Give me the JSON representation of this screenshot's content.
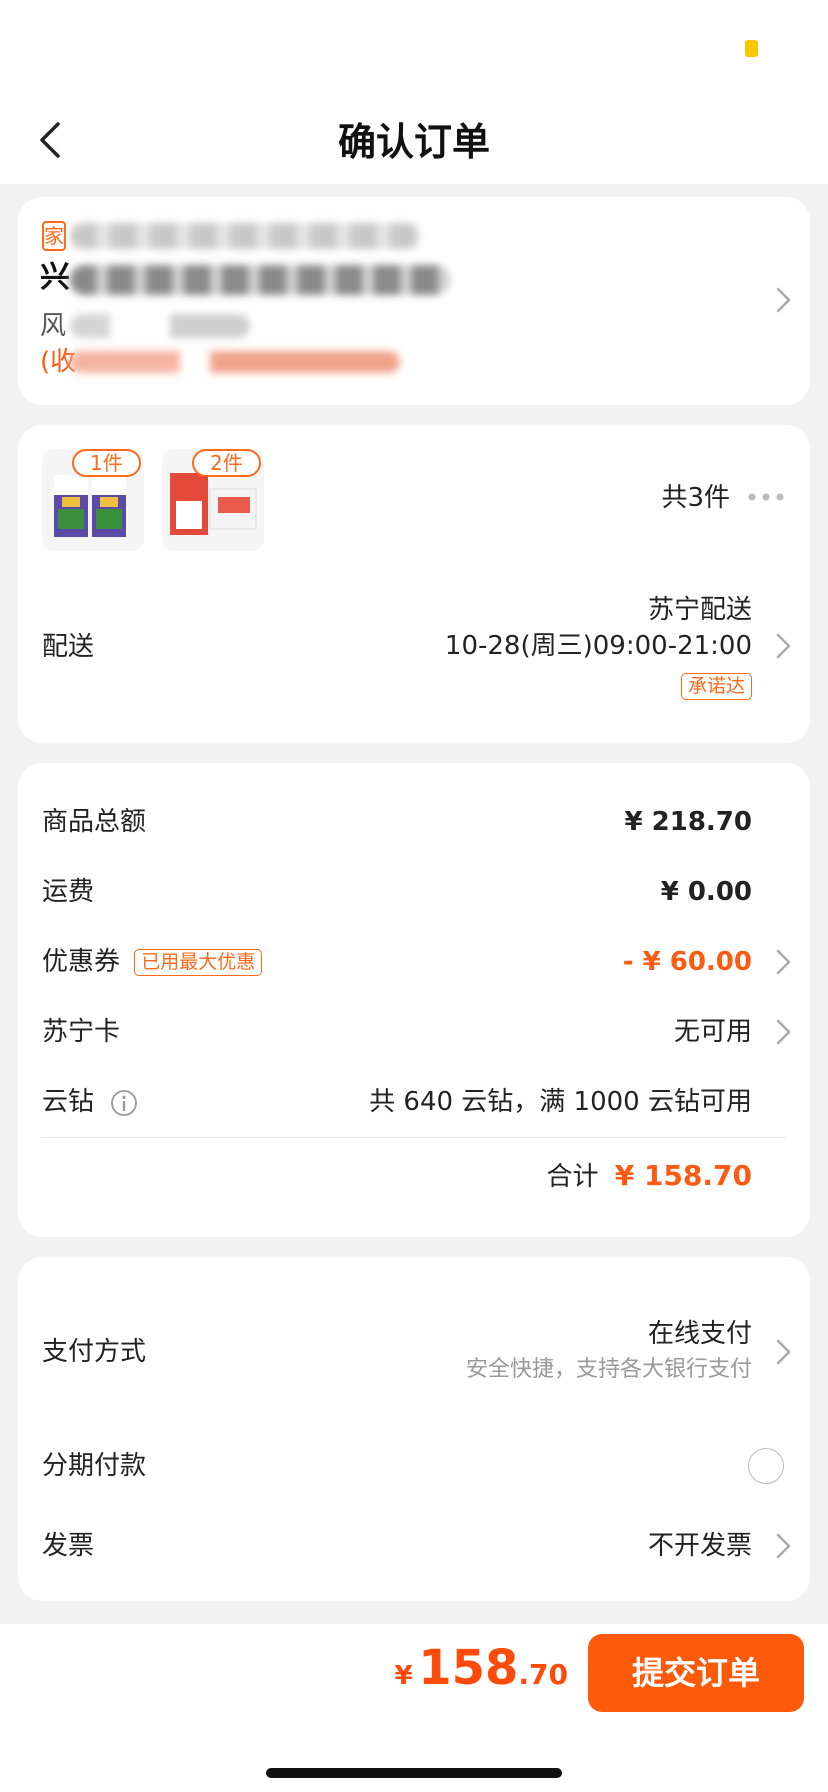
{
  "header": {
    "title": "确认订单"
  },
  "address": {
    "tag": "家",
    "line1_initial": "兴",
    "line2_initial": "风",
    "line3_initial": "(收"
  },
  "goods": {
    "items": [
      {
        "qty": "1件",
        "name": "milk-product-thumbnail"
      },
      {
        "qty": "2件",
        "name": "box-product-thumbnail"
      }
    ],
    "total_count": "共3件"
  },
  "delivery": {
    "label": "配送",
    "method": "苏宁配送",
    "time": "10-28(周三)09:00-21:00",
    "promise_tag": "承诺达"
  },
  "pricing": {
    "goods_total_label": "商品总额",
    "goods_total_value": "¥ 218.70",
    "shipping_label": "运费",
    "shipping_value": "¥ 0.00",
    "coupon_label": "优惠券",
    "coupon_tag": "已用最大优惠",
    "coupon_value": "- ¥ 60.00",
    "card_label": "苏宁卡",
    "card_value": "无可用",
    "yunzuan_label": "云钻",
    "yunzuan_value": "共 640 云钻，满 1000 云钻可用",
    "total_label": "合计",
    "total_value": "¥ 158.70"
  },
  "payment": {
    "method_label": "支付方式",
    "method_value": "在线支付",
    "method_sub": "安全快捷，支持各大银行支付",
    "installment_label": "分期付款",
    "invoice_label": "发票",
    "invoice_value": "不开发票"
  },
  "footer": {
    "currency": "¥",
    "amount_int": "158",
    "amount_dec": ".70",
    "submit_label": "提交订单"
  },
  "colors": {
    "accent": "#ff5a0a",
    "status_battery": "#f5c800"
  }
}
